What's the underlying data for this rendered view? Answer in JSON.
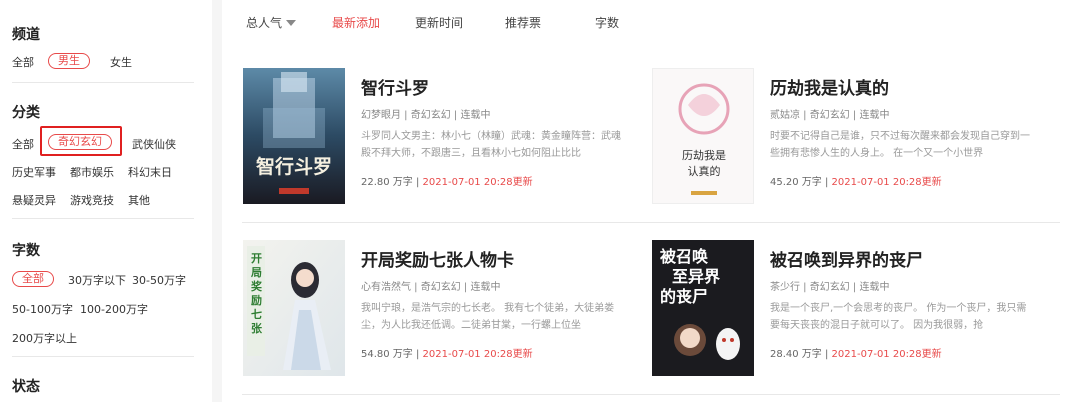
{
  "sidebar": {
    "channel": {
      "title": "频道",
      "options": [
        "全部",
        "男生",
        "女生"
      ]
    },
    "category": {
      "title": "分类",
      "options": [
        "全部",
        "奇幻玄幻",
        "武侠仙侠",
        "历史军事",
        "都市娱乐",
        "科幻末日",
        "悬疑灵异",
        "游戏竞技",
        "其他"
      ]
    },
    "wordcount": {
      "title": "字数",
      "options": [
        "全部",
        "30万字以下",
        "30-50万字",
        "50-100万字",
        "100-200万字",
        "200万字以上"
      ]
    },
    "status": {
      "title": "状态"
    }
  },
  "sortbar": {
    "items": [
      "总人气",
      "最新添加",
      "更新时间",
      "推荐票",
      "字数"
    ]
  },
  "books": [
    {
      "title": "智行斗罗",
      "meta": "幻梦眼月 | 奇幻玄幻 | 连载中",
      "desc": "斗罗同人文男主：林小七（林瞳）武魂：黄金瞳阵营：武魂殿不拜大师，不跟唐三，且看林小七如何阻止比比",
      "words": "22.80 万字",
      "sep": " | ",
      "updated": "2021-07-01 20:28更新",
      "cover_text": "智行斗罗"
    },
    {
      "title": "历劫我是认真的",
      "meta": "贰姑凉 | 奇幻玄幻 | 连载中",
      "desc": "时要不记得自己是谁，只不过每次醒来都会发现自己穿到一些拥有悲惨人生的人身上。 在一个又一个小世界",
      "words": "45.20 万字",
      "sep": " | ",
      "updated": "2021-07-01 20:28更新",
      "cover_text": "历劫我是认真的"
    },
    {
      "title": "开局奖励七张人物卡",
      "meta": "心有浩然气 | 奇幻玄幻 | 连载中",
      "desc": "我叫宁琅，是浩气宗的七长老。 我有七个徒弟，大徒弟娄尘，为人比我还低调。二徒弟甘棠，一行螺上位坐",
      "words": "54.80 万字",
      "sep": " | ",
      "updated": "2021-07-01 20:28更新",
      "cover_text": "开局奖励七张人物卡"
    },
    {
      "title": "被召唤到异界的丧尸",
      "meta": "茶少行 | 奇幻玄幻 | 连载中",
      "desc": "我是一个丧尸,一个会思考的丧尸。 作为一个丧尸，我只需要每天丧丧的混日子就可以了。 因为我很弱，抢",
      "words": "28.40 万字",
      "sep": " | ",
      "updated": "2021-07-01 20:28更新",
      "cover_text": "被召唤至异界的丧尸"
    }
  ]
}
